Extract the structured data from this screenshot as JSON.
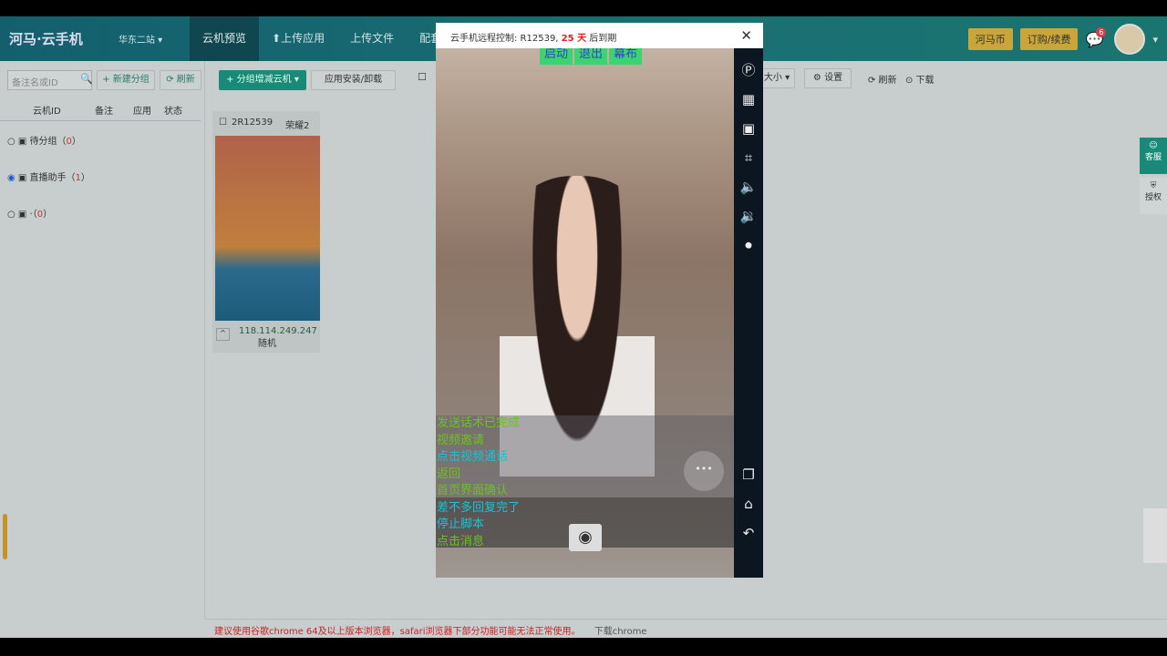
{
  "header": {
    "logo": "河马·云手机",
    "region": "华东二站 ▾",
    "nav": [
      "云机预览",
      "⬆上传应用",
      "上传文件",
      "配套服"
    ],
    "coin_btn": "河马币",
    "order_btn": "订购/续费",
    "message_count": "6"
  },
  "left": {
    "search_placeholder": "备注名或ID",
    "new_group": "+ 新建分组",
    "refresh": "⟳ 刷新",
    "columns": [
      "云机ID",
      "备注",
      "应用",
      "状态"
    ],
    "groups": [
      {
        "name": "待分组",
        "count": "0"
      },
      {
        "name": "直播助手",
        "count": "1"
      },
      {
        "name": "·",
        "count": "0"
      }
    ]
  },
  "toolbar": {
    "group_btn": "+ 分组增减云机 ▾",
    "install_btn": "应用安装/卸载",
    "size_select": "大小 ▾",
    "settings": "⚙ 设置",
    "refresh": "⟳ 刷新",
    "download": "⊙ 下载"
  },
  "card": {
    "id": "2R12539",
    "remark": "荣耀2",
    "ip": "118.114.249.247",
    "mode": "随机"
  },
  "footer": {
    "warning": "建议使用谷歌chrome 64及以上版本浏览器，safari浏览器下部分功能可能无法正常使用。",
    "download": "下载chrome"
  },
  "modal": {
    "title_prefix": "云手机远程控制: R12539, ",
    "days": "25 天",
    "title_suffix": " 后到期",
    "top_buttons": [
      "启动",
      "退出",
      "幕布"
    ],
    "logs": [
      {
        "text": "发送话术已完成",
        "color": "g"
      },
      {
        "text": "视频邀请",
        "color": "g"
      },
      {
        "text": "点击视频通话",
        "color": "c"
      },
      {
        "text": "返回",
        "color": "g"
      },
      {
        "text": "首页界面确认",
        "color": "g"
      },
      {
        "text": "差不多回复完了",
        "color": "c"
      },
      {
        "text": "停止脚本",
        "color": "c"
      },
      {
        "text": "点击消息",
        "color": "g"
      }
    ]
  },
  "float": {
    "service": "客服",
    "auth": "授权"
  },
  "colors": {
    "accent": "#1a6f72",
    "expiry_red": "#e02020"
  }
}
